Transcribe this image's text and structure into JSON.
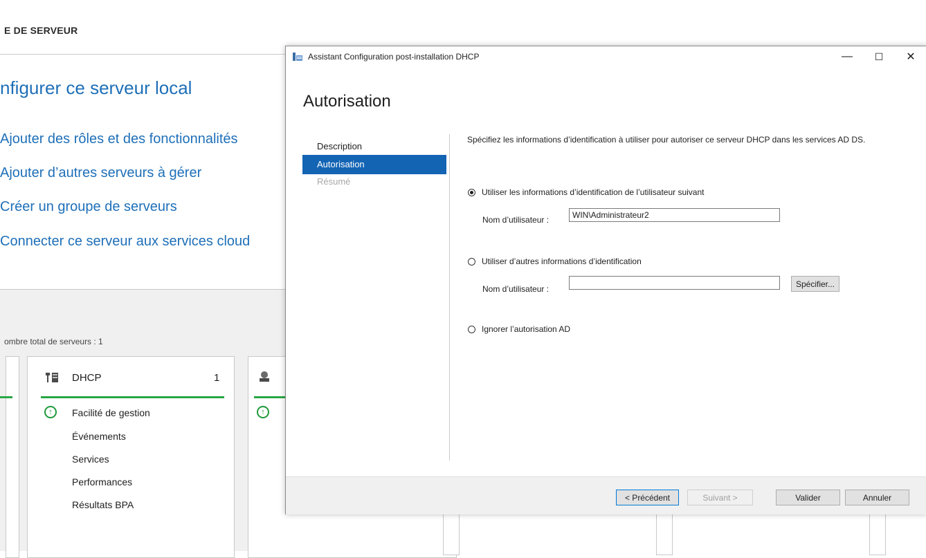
{
  "background": {
    "title": "E DE SERVEUR",
    "heading": "nfigurer ce serveur local",
    "links": [
      "Ajouter des rôles et des fonctionnalités",
      "Ajouter d’autres serveurs à gérer",
      "Créer un groupe de serveurs",
      "Connecter ce serveur aux services cloud"
    ],
    "total_servers": "ombre total de serveurs : 1",
    "tile": {
      "name": "DHCP",
      "count": "1",
      "items": [
        "Facilité de gestion",
        "Événements",
        "Services",
        "Performances",
        "Résultats BPA"
      ]
    }
  },
  "dialog": {
    "title": "Assistant Configuration post-installation DHCP",
    "window_controls": {
      "minimize": "—",
      "maximize": "☐",
      "close": "✕"
    },
    "heading": "Autorisation",
    "nav": [
      "Description",
      "Autorisation",
      "Résumé"
    ],
    "description": "Spécifiez les informations d’identification à utiliser pour autoriser ce serveur DHCP dans les services AD DS.",
    "option1": {
      "label": "Utiliser les informations d’identification de l’utilisateur suivant",
      "selected": true,
      "user_label": "Nom d’utilisateur :",
      "user_value": "WIN\\Administrateur2"
    },
    "option2": {
      "label": "Utiliser d’autres informations d’identification",
      "selected": false,
      "user_label": "Nom d’utilisateur :",
      "user_value": "",
      "specify_button": "Spécifier..."
    },
    "option3": {
      "label": "Ignorer l’autorisation AD",
      "selected": false
    },
    "buttons": {
      "previous": "< Précédent",
      "next": "Suivant >",
      "validate": "Valider",
      "cancel": "Annuler"
    }
  },
  "colors": {
    "accent": "#1464b4",
    "link": "#1e6fb8",
    "status_green": "#28a745"
  }
}
